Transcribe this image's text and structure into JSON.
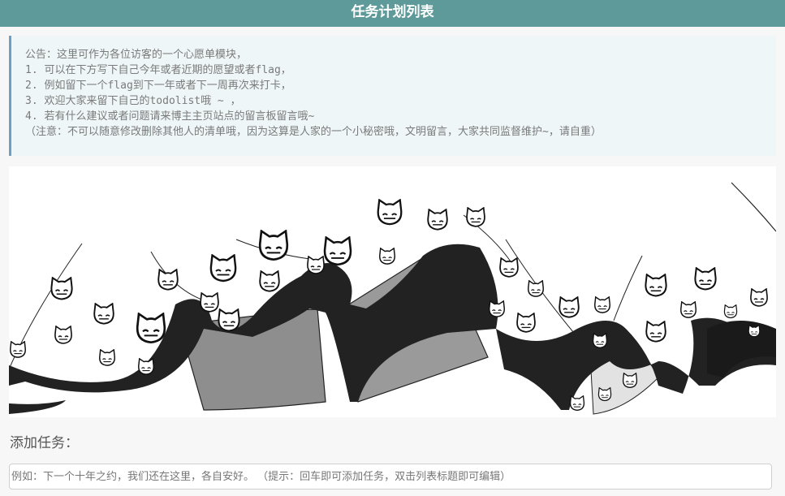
{
  "header": {
    "title": "任务计划列表"
  },
  "notice": {
    "lines": [
      "公告：这里可作为各位访客的一个心愿单模块，",
      "1. 可以在下方写下自己今年或者近期的愿望或者flag，",
      "2. 例如留下一个flag到下一年或者下一周再次来打卡，",
      "3. 欢迎大家来留下自己的todolist哦 ~ ，",
      "4. 若有什么建议或者问题请来博主主页站点的留言板留言哦~",
      "（注意：不可以随意修改删除其他人的清单哦，因为这算是人家的一个小秘密哦，文明留言，大家共同监督维护~，请自重）"
    ]
  },
  "add_task": {
    "label": "添加任务：",
    "placeholder": "例如：下一个十年之约，我们还在这里，各自安好。 （提示：回车即可添加任务，双击列表标题即可编辑）"
  },
  "colors": {
    "header_bg": "#5f9a9a",
    "notice_bg": "#eef6f8",
    "notice_border": "#6aa0c8"
  }
}
